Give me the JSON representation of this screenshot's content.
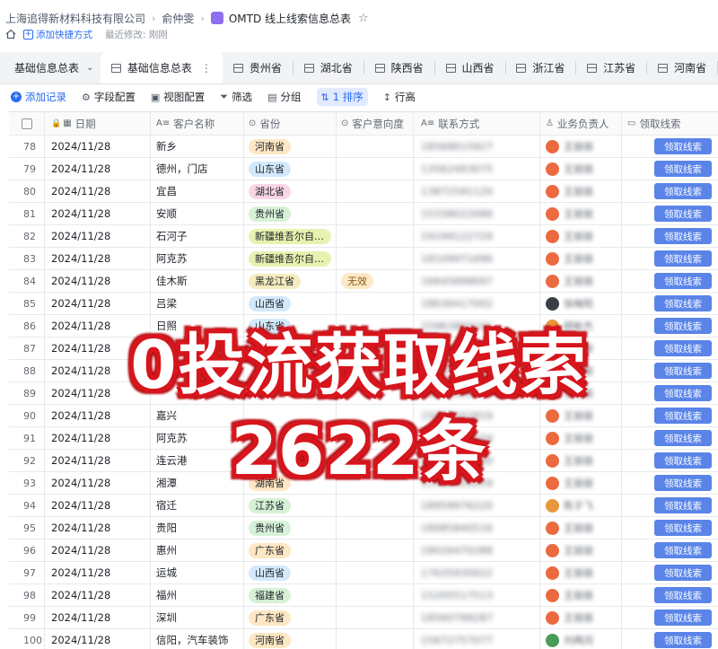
{
  "breadcrumb": {
    "company": "上海追得新材料科技有限公司",
    "person": "俞仲雯",
    "doc_title": "OMTD 线上线索信息总表"
  },
  "subline": {
    "add_shortcut": "添加快捷方式",
    "modified": "最近修改: 刚刚"
  },
  "tabs": {
    "dropdown_label": "基础信息总表",
    "items": [
      {
        "label": "基础信息总表",
        "active": true
      },
      {
        "label": "贵州省"
      },
      {
        "label": "湖北省"
      },
      {
        "label": "陕西省"
      },
      {
        "label": "山西省"
      },
      {
        "label": "浙江省"
      },
      {
        "label": "江苏省"
      },
      {
        "label": "河南省"
      }
    ]
  },
  "toolbar": {
    "add_record": "添加记录",
    "field_config": "字段配置",
    "view_config": "视图配置",
    "filter": "筛选",
    "group": "分组",
    "sort": "1 排序",
    "row_height": "行高"
  },
  "columns": {
    "date": "日期",
    "customer_name": "客户名称",
    "province": "省份",
    "intent": "客户意向度",
    "contact": "联系方式",
    "owner": "业务负责人",
    "claim": "领取线索"
  },
  "claim_label": "领取线索",
  "rows": [
    {
      "num": "78",
      "date": "2024/11/28",
      "name": "新乡",
      "province": "河南省",
      "pcolor": "#fde7c4",
      "intent": "",
      "phone": "18568615927",
      "owner": "王丽丽",
      "acolor": "#ec6a3f"
    },
    {
      "num": "79",
      "date": "2024/11/28",
      "name": "德州，门店",
      "province": "山东省",
      "pcolor": "#d3e9fb",
      "intent": "",
      "phone": "13562493075",
      "owner": "王丽丽",
      "acolor": "#ec6a3f"
    },
    {
      "num": "80",
      "date": "2024/11/28",
      "name": "宜昌",
      "province": "湖北省",
      "pcolor": "#f8d6e6",
      "intent": "",
      "phone": "13872591120",
      "owner": "王丽丽",
      "acolor": "#ec6a3f"
    },
    {
      "num": "81",
      "date": "2024/11/28",
      "name": "安顺",
      "province": "贵州省",
      "pcolor": "#d6f1d6",
      "intent": "",
      "phone": "15338022086",
      "owner": "王丽丽",
      "acolor": "#ec6a3f"
    },
    {
      "num": "82",
      "date": "2024/11/28",
      "name": "石河子",
      "province": "新疆维吾尔自治区",
      "pcolor": "#e7f2b0",
      "intent": "",
      "phone": "19199122729",
      "owner": "王丽丽",
      "acolor": "#ec6a3f"
    },
    {
      "num": "83",
      "date": "2024/11/28",
      "name": "阿克苏",
      "province": "新疆维吾尔自治区",
      "pcolor": "#e7f2b0",
      "intent": "",
      "phone": "18109971696",
      "owner": "王丽丽",
      "acolor": "#ec6a3f"
    },
    {
      "num": "84",
      "date": "2024/11/28",
      "name": "佳木斯",
      "province": "黑龙江省",
      "pcolor": "#f5ecc0",
      "intent": "无效",
      "phone": "16645898697",
      "owner": "王丽丽",
      "acolor": "#ec6a3f"
    },
    {
      "num": "85",
      "date": "2024/11/28",
      "name": "吕梁",
      "province": "山西省",
      "pcolor": "#d3e9fb",
      "intent": "",
      "phone": "18636417002",
      "owner": "徐梅阳",
      "acolor": "#3a3f47"
    },
    {
      "num": "86",
      "date": "2024/11/28",
      "name": "日照",
      "province": "山东省",
      "pcolor": "#d3e9fb",
      "intent": "",
      "phone": "15963860101",
      "owner": "顾彬杰",
      "acolor": "#e8973c"
    },
    {
      "num": "87",
      "date": "2024/11/28",
      "name": "",
      "province": "",
      "pcolor": "#d6f1d6",
      "intent": "",
      "phone": "13611105593",
      "owner": "王丽丽",
      "acolor": "#ec6a3f"
    },
    {
      "num": "88",
      "date": "2024/11/28",
      "name": "",
      "province": "",
      "pcolor": "#e7f2b0",
      "intent": "",
      "phone": "18965420321",
      "owner": "王丽丽",
      "acolor": "#ec6a3f"
    },
    {
      "num": "89",
      "date": "2024/11/28",
      "name": "",
      "province": "",
      "pcolor": "#d3e9fb",
      "intent": "",
      "phone": "13972004566",
      "owner": "王丽丽",
      "acolor": "#ec6a3f"
    },
    {
      "num": "90",
      "date": "2024/11/28",
      "name": "嘉兴",
      "province": "",
      "pcolor": "#d6f1d6",
      "intent": "",
      "phone": "15057342819",
      "owner": "王丽丽",
      "acolor": "#ec6a3f"
    },
    {
      "num": "91",
      "date": "2024/11/28",
      "name": "阿克苏",
      "province": "",
      "pcolor": "#e7f2b0",
      "intent": "",
      "phone": "18099752334",
      "owner": "王丽丽",
      "acolor": "#ec6a3f"
    },
    {
      "num": "92",
      "date": "2024/11/28",
      "name": "连云港",
      "province": "",
      "pcolor": "#d6f1d6",
      "intent": "",
      "phone": "13815218760",
      "owner": "王丽丽",
      "acolor": "#ec6a3f"
    },
    {
      "num": "93",
      "date": "2024/11/28",
      "name": "湘潭",
      "province": "湖南省",
      "pcolor": "#fde7c4",
      "intent": "",
      "phone": "13786420059",
      "owner": "王丽丽",
      "acolor": "#ec6a3f"
    },
    {
      "num": "94",
      "date": "2024/11/28",
      "name": "宿迁",
      "province": "江苏省",
      "pcolor": "#d6f1d6",
      "intent": "",
      "phone": "18959976220",
      "owner": "陈子飞",
      "acolor": "#e8973c"
    },
    {
      "num": "95",
      "date": "2024/11/28",
      "name": "贵阳",
      "province": "贵州省",
      "pcolor": "#d6f1d6",
      "intent": "",
      "phone": "18085840516",
      "owner": "王丽丽",
      "acolor": "#ec6a3f"
    },
    {
      "num": "96",
      "date": "2024/11/28",
      "name": "惠州",
      "province": "广东省",
      "pcolor": "#fde7c4",
      "intent": "",
      "phone": "18026470288",
      "owner": "王丽丽",
      "acolor": "#ec6a3f"
    },
    {
      "num": "97",
      "date": "2024/11/28",
      "name": "运城",
      "province": "山西省",
      "pcolor": "#d3e9fb",
      "intent": "",
      "phone": "17635930022",
      "owner": "王丽丽",
      "acolor": "#ec6a3f"
    },
    {
      "num": "98",
      "date": "2024/11/28",
      "name": "福州",
      "province": "福建省",
      "pcolor": "#d6f1d6",
      "intent": "",
      "phone": "15205517513",
      "owner": "王丽丽",
      "acolor": "#ec6a3f"
    },
    {
      "num": "99",
      "date": "2024/11/28",
      "name": "深圳",
      "province": "广东省",
      "pcolor": "#fde7c4",
      "intent": "",
      "phone": "18560798287",
      "owner": "王丽丽",
      "acolor": "#ec6a3f"
    },
    {
      "num": "100",
      "date": "2024/11/28",
      "name": "信阳，汽车装饰",
      "province": "河南省",
      "pcolor": "#fde7c4",
      "intent": "",
      "phone": "15672757077",
      "owner": "刘两闰",
      "acolor": "#4b9b58"
    }
  ],
  "overlay": {
    "line1": "0投流获取线索",
    "line2": "2622条",
    "color": "#d7161d"
  }
}
